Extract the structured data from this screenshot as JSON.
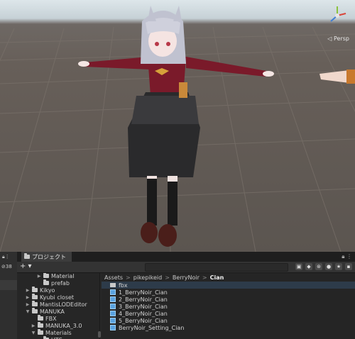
{
  "scene": {
    "view_mode": "Persp",
    "gizmo": "axis-gizmo-icon"
  },
  "project": {
    "tab_label": "プロジェクト",
    "hidden_count": "38",
    "toolbar": {
      "add": "+ ▾"
    },
    "tree": [
      {
        "label": "Material",
        "indent": 3,
        "arrow": "▶"
      },
      {
        "label": "prefab",
        "indent": 3,
        "arrow": ""
      },
      {
        "label": "Kikyo",
        "indent": 1,
        "arrow": "▶"
      },
      {
        "label": "Kyubi closet",
        "indent": 1,
        "arrow": "▶"
      },
      {
        "label": "MantisLODEditor",
        "indent": 1,
        "arrow": "▶"
      },
      {
        "label": "MANUKA",
        "indent": 1,
        "arrow": "▼"
      },
      {
        "label": "FBX",
        "indent": 2,
        "arrow": ""
      },
      {
        "label": "MANUKA_3.0",
        "indent": 2,
        "arrow": "▶"
      },
      {
        "label": "Materials",
        "indent": 2,
        "arrow": "▼"
      },
      {
        "label": "UTS...",
        "indent": 3,
        "arrow": ""
      }
    ],
    "breadcrumb": [
      "Assets",
      "pikepikeid",
      "BerryNoir",
      "Cian"
    ],
    "files": [
      {
        "label": "fbx",
        "type": "folder"
      },
      {
        "label": "1_BerryNoir_Cian",
        "type": "prefab"
      },
      {
        "label": "2_BerryNoir_Cian",
        "type": "prefab"
      },
      {
        "label": "3_BerryNoir_Cian",
        "type": "prefab"
      },
      {
        "label": "4_BerryNoir_Cian",
        "type": "prefab"
      },
      {
        "label": "5_BerryNoir_Cian",
        "type": "prefab"
      },
      {
        "label": "BerryNoir_Setting_Cian",
        "type": "prefab"
      }
    ],
    "colors": {
      "panel_bg": "#282828",
      "highlight": "#2d3b4a",
      "prefab": "#5aa3e0"
    }
  }
}
